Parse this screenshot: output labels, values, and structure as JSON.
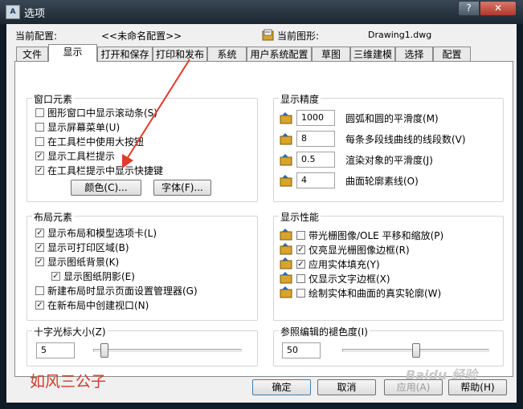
{
  "window": {
    "title": "选项",
    "help_glyph": "?",
    "close_glyph": "✕",
    "current_profile_label": "当前配置:",
    "current_profile_value": "<<未命名配置>>",
    "current_drawing_label": "当前图形:",
    "current_drawing_value": "Drawing1.dwg"
  },
  "tabs": [
    {
      "label": "文件"
    },
    {
      "label": "显示"
    },
    {
      "label": "打开和保存"
    },
    {
      "label": "打印和发布"
    },
    {
      "label": "系统"
    },
    {
      "label": "用户系统配置"
    },
    {
      "label": "草图"
    },
    {
      "label": "三维建模"
    },
    {
      "label": "选择"
    },
    {
      "label": "配置"
    }
  ],
  "window_elements": {
    "title": "窗口元素",
    "checkboxes": [
      {
        "label": "图形窗口中显示滚动条(S)",
        "checked": false
      },
      {
        "label": "显示屏幕菜单(U)",
        "checked": false
      },
      {
        "label": "在工具栏中使用大按钮",
        "checked": false
      },
      {
        "label": "显示工具栏提示",
        "checked": true
      },
      {
        "label": "在工具栏提示中显示快捷键",
        "checked": true
      }
    ],
    "colors_button": "颜色(C)...",
    "fonts_button": "字体(F)..."
  },
  "display_resolution": {
    "title": "显示精度",
    "items": [
      {
        "value": "1000",
        "label": "圆弧和圆的平滑度(M)"
      },
      {
        "value": "8",
        "label": "每条多段线曲线的线段数(V)"
      },
      {
        "value": "0.5",
        "label": "渲染对象的平滑度(J)"
      },
      {
        "value": "4",
        "label": "曲面轮廓素线(O)"
      }
    ]
  },
  "layout_elements": {
    "title": "布局元素",
    "checkboxes": [
      {
        "label": "显示布局和模型选项卡(L)",
        "checked": true
      },
      {
        "label": "显示可打印区域(B)",
        "checked": true
      },
      {
        "label": "显示图纸背景(K)",
        "checked": true
      },
      {
        "label": "显示图纸阴影(E)",
        "checked": true
      },
      {
        "label": "新建布局时显示页面设置管理器(G)",
        "checked": false
      },
      {
        "label": "在新布局中创建视口(N)",
        "checked": true
      }
    ]
  },
  "display_performance": {
    "title": "显示性能",
    "checkboxes": [
      {
        "label": "带光栅图像/OLE 平移和缩放(P)",
        "checked": false
      },
      {
        "label": "仅亮显光栅图像边框(R)",
        "checked": true
      },
      {
        "label": "应用实体填充(Y)",
        "checked": true
      },
      {
        "label": "仅显示文字边框(X)",
        "checked": false
      },
      {
        "label": "绘制实体和曲面的真实轮廓(W)",
        "checked": false
      }
    ]
  },
  "crosshair": {
    "title": "十字光标大小(Z)",
    "value": "5",
    "level": 0.05
  },
  "xref_fade": {
    "title": "参照编辑的褪色度(I)",
    "value": "50",
    "level": 0.5
  },
  "watermark": "如风三公子",
  "baidu_mark": "Baidu 经验",
  "buttons": {
    "ok": "确定",
    "cancel": "取消",
    "apply": "应用(A)",
    "help": "帮助(H)"
  },
  "colors": {
    "accent_red": "#d03b28",
    "close_red": "#c0392b"
  }
}
